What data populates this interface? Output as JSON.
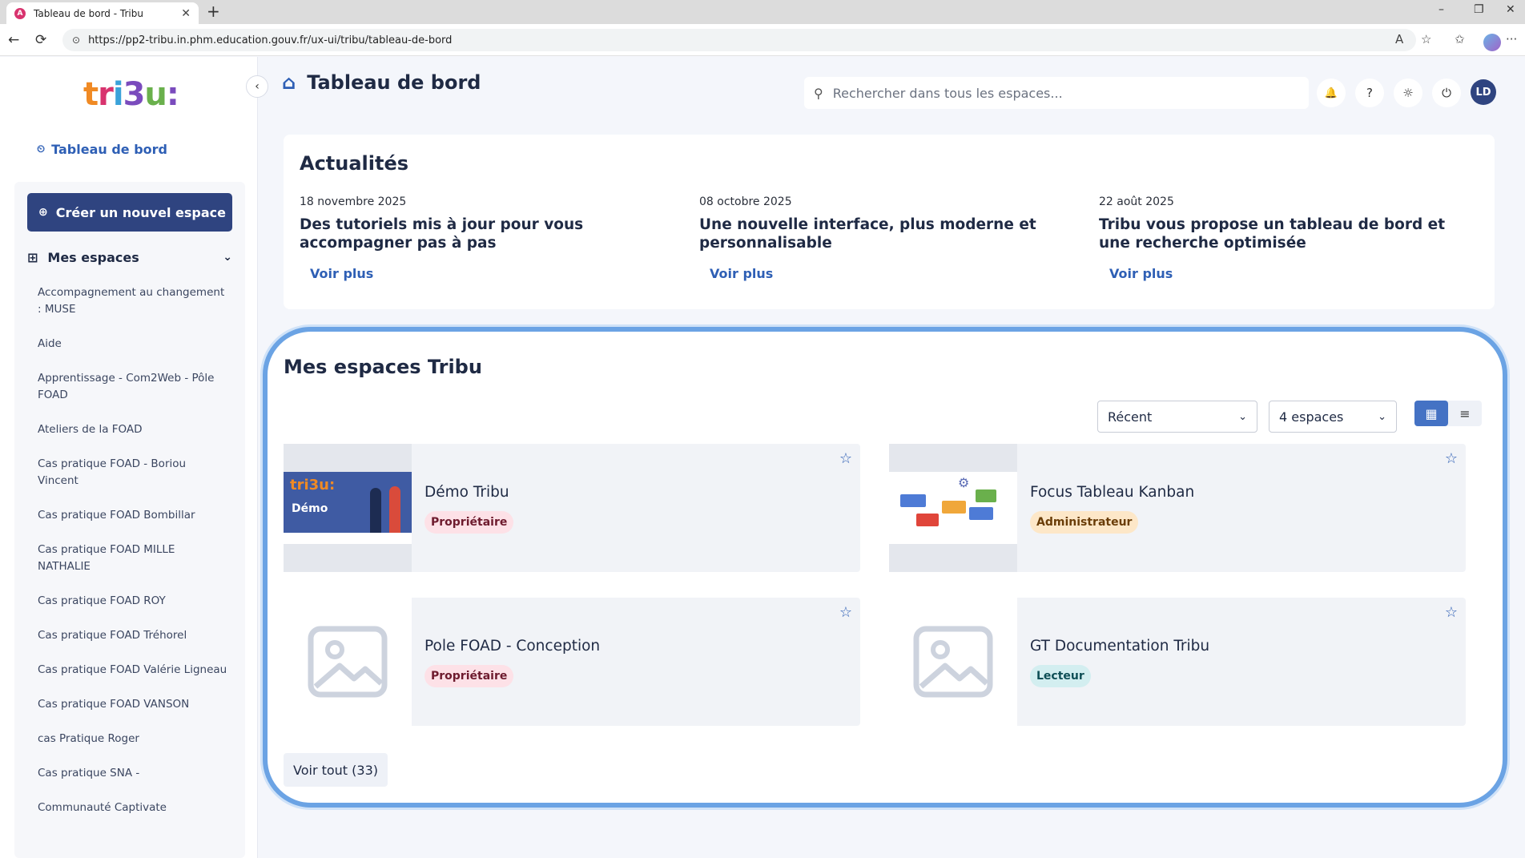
{
  "browser": {
    "tab_title": "Tableau de bord - Tribu",
    "url": "https://pp2-tribu.in.phm.education.gouv.fr/ux-ui/tribu/tableau-de-bord"
  },
  "icons": {
    "back": "←",
    "reload": "⟳",
    "lock": "⊙",
    "read_aloud": "A",
    "favorite": "☆",
    "favorites": "✩",
    "more": "···",
    "minimize": "–",
    "restore": "❐",
    "close": "✕",
    "new_tab": "+",
    "chevron_left": "‹",
    "chevron_down": "⌄",
    "dashboard": "⏲",
    "create": "⊕",
    "grid": "⊞",
    "home": "⌂",
    "search": "⚲",
    "bell": "🔔",
    "help": "?",
    "sun": "☼",
    "power": "⏻",
    "star": "☆",
    "grid_view": "▦",
    "list_view": "≡",
    "image": "🖼",
    "gear": "⚙"
  },
  "colors": {
    "primary": "#2f4480",
    "link": "#2e5fb5",
    "highlight_border": "#6ba3e4"
  },
  "sidebar": {
    "logo_text": "tri3u:",
    "dashboard_link": "Tableau de bord",
    "create_button": "Créer un nouvel espace",
    "my_spaces_label": "Mes espaces",
    "items": [
      "Accompagnement au changement : MUSE",
      "Aide",
      "Apprentissage - Com2Web - Pôle FOAD",
      "Ateliers de la FOAD",
      "Cas pratique FOAD - Boriou Vincent",
      "Cas pratique FOAD Bombillar",
      "Cas pratique FOAD MILLE NATHALIE",
      "Cas pratique FOAD ROY",
      "Cas pratique FOAD Tréhorel",
      "Cas pratique FOAD Valérie Ligneau",
      "Cas pratique FOAD VANSON",
      "cas Pratique Roger",
      "Cas pratique SNA -",
      "Communauté Captivate"
    ]
  },
  "header": {
    "title": "Tableau de bord",
    "search_placeholder": "Rechercher dans tous les espaces...",
    "avatar_initials": "LD"
  },
  "news": {
    "title": "Actualités",
    "items": [
      {
        "date": "18 novembre 2025",
        "headline": "Des tutoriels mis à jour pour vous accompagner pas à pas",
        "more": "Voir plus"
      },
      {
        "date": "08 octobre 2025",
        "headline": "Une nouvelle interface, plus moderne et personnalisable",
        "more": "Voir plus"
      },
      {
        "date": "22 août 2025",
        "headline": "Tribu vous propose un tableau de bord et une recherche optimisée",
        "more": "Voir plus"
      }
    ]
  },
  "spaces": {
    "title": "Mes espaces Tribu",
    "sort_value": "Récent",
    "count_value": "4 espaces",
    "cards": [
      {
        "name": "Démo Tribu",
        "role": "Propriétaire",
        "thumb_logo": "tri3u:",
        "thumb_text": "Démo"
      },
      {
        "name": "Focus Tableau Kanban",
        "role": "Administrateur"
      },
      {
        "name": "Pole FOAD - Conception",
        "role": "Propriétaire"
      },
      {
        "name": "GT Documentation Tribu",
        "role": "Lecteur"
      }
    ],
    "view_all": "Voir tout (33)"
  }
}
